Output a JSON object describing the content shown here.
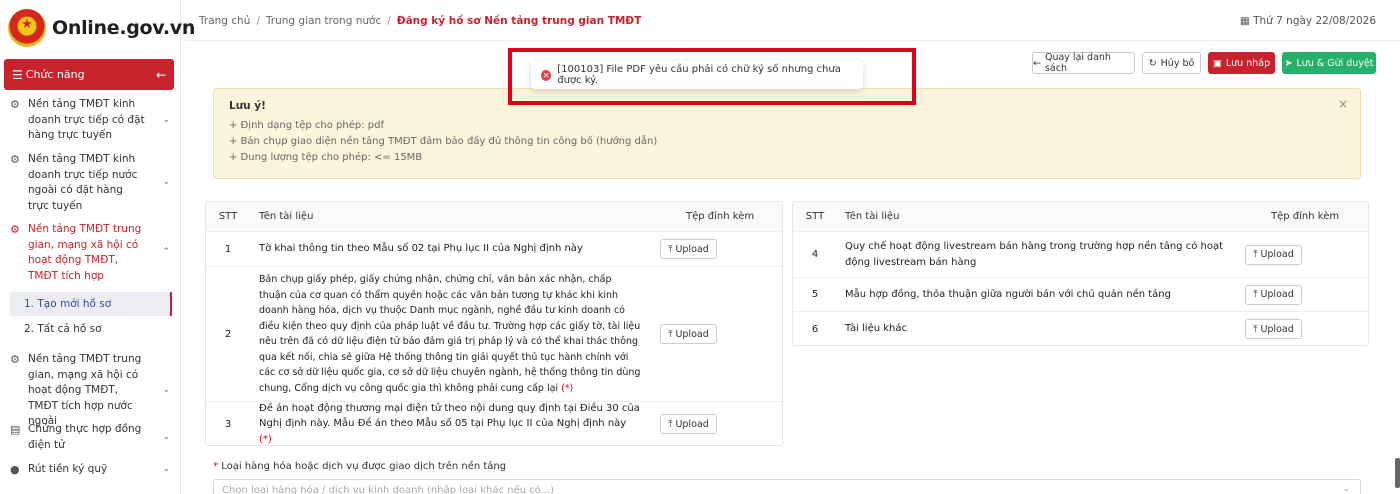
{
  "logo": {
    "text": "Online.gov.vn"
  },
  "menu": {
    "label": "Chức năng",
    "collapse_icon": "arrow-left-icon"
  },
  "sidebar": {
    "items": [
      {
        "label": "Nền tảng TMĐT kinh doanh trực tiếp có đặt hàng trực tuyến",
        "icon": "gear-icon"
      },
      {
        "label": "Nền tảng TMĐT kinh doanh trực tiếp nước ngoài có đặt hàng trực tuyến",
        "icon": "gear-icon"
      },
      {
        "label": "Nền tảng TMĐT trung gian, mạng xã hội có hoạt động TMĐT, TMĐT tích hợp",
        "icon": "gear-icon"
      },
      {
        "label": "Nền tảng TMĐT trung gian, mạng xã hội có hoạt động TMĐT, TMĐT tích hợp nước ngoài",
        "icon": "gear-icon"
      },
      {
        "label": "Chứng thực hợp đồng điện tử",
        "icon": "document-icon"
      },
      {
        "label": "Rút tiền ký quỹ",
        "icon": "coin-icon"
      }
    ],
    "subitems": [
      {
        "label": "1. Tạo mới hồ sơ"
      },
      {
        "label": "2. Tất cả hồ sơ"
      }
    ]
  },
  "breadcrumb": {
    "home": "Trang chủ",
    "parent": "Trung gian trong nước",
    "current": "Đăng ký hồ sơ Nền tảng trung gian TMĐT"
  },
  "date": "Thứ 7 ngày 22/08/2026",
  "actions": {
    "back": "Quay lại danh sách",
    "cancel": "Hủy bỏ",
    "draft": "Lưu nháp",
    "submit": "Lưu & Gửi duyệt"
  },
  "toast": {
    "message": "[100103] File PDF yêu cầu phải có chữ ký số nhưng chưa được ký."
  },
  "notice": {
    "title": "Lưu ý!",
    "lines": [
      "+ Định dạng tệp cho phép: pdf",
      "+ Bản chụp giao diện nền tảng TMĐT đảm bảo đầy đủ thông tin công bố (hướng dẫn)",
      "+ Dung lượng tệp cho phép: <= 15MB"
    ]
  },
  "table_headers": {
    "stt": "STT",
    "name": "Tên tài liệu",
    "attachment": "Tệp đính kèm"
  },
  "upload_label": "Upload",
  "left_table": [
    {
      "stt": "1",
      "name": "Tờ khai thông tin theo Mẫu số 02 tại Phụ lục II của Nghị định này",
      "required": ""
    },
    {
      "stt": "2",
      "name": "Bản chụp giấy phép, giấy chứng nhận, chứng chỉ, văn bản xác nhận, chấp thuận của cơ quan có thẩm quyền hoặc các văn bản tương tự khác khi kinh doanh hàng hóa, dịch vụ thuộc Danh mục ngành, nghề đầu tư kinh doanh có điều kiện theo quy định của pháp luật về đầu tư. Trường hợp các giấy tờ, tài liệu nêu trên đã có dữ liệu điện tử bảo đảm giá trị pháp lý và có thể khai thác thông qua kết nối, chia sẻ giữa Hệ thống thông tin giải quyết thủ tục hành chính với các cơ sở dữ liệu quốc gia, cơ sở dữ liệu chuyên ngành, hệ thống thông tin dùng chung, Cổng dịch vụ công quốc gia thì không phải cung cấp lại",
      "required": "(*)"
    },
    {
      "stt": "3",
      "name": "Đề án hoạt động thương mại điện tử theo nội dung quy định tại Điều 30 của Nghị định này. Mẫu Đề án theo Mẫu số 05 tại Phụ lục II của Nghị định này",
      "required": "(*)"
    }
  ],
  "right_table": [
    {
      "stt": "4",
      "name": "Quy chế hoạt động livestream bán hàng trong trường hợp nền tảng có hoạt động livestream bán hàng"
    },
    {
      "stt": "5",
      "name": "Mẫu hợp đồng, thỏa thuận giữa người bán với chủ quản nền tảng"
    },
    {
      "stt": "6",
      "name": "Tài liệu khác"
    }
  ],
  "goods": {
    "required_mark": "*",
    "label": "Loại hàng hóa hoặc dịch vụ được giao dịch trên nền tảng",
    "placeholder": "Chọn loại hàng hóa / dịch vụ kinh doanh (nhập loại khác nếu có...)"
  }
}
